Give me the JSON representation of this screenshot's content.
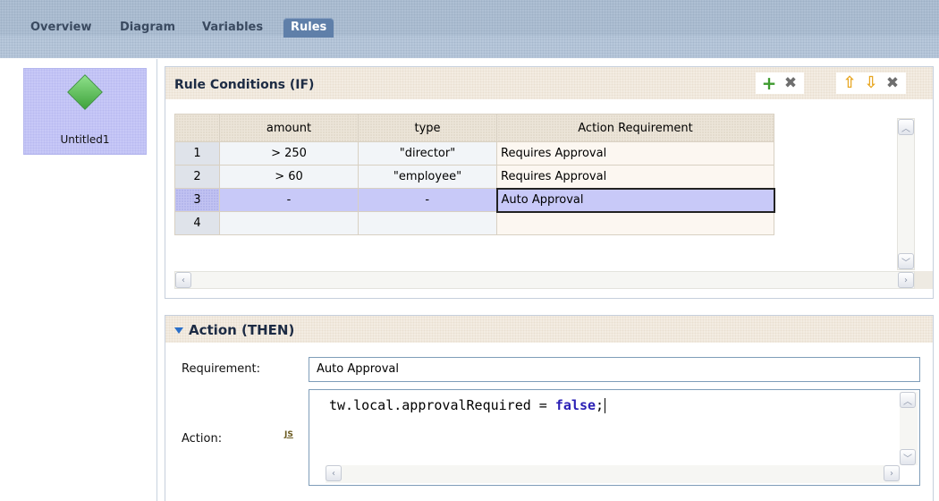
{
  "tabs": [
    {
      "label": "Overview"
    },
    {
      "label": "Diagram"
    },
    {
      "label": "Variables"
    },
    {
      "label": "Rules",
      "active": true
    }
  ],
  "palette": {
    "step_label": "Untitled1",
    "step_icon": "green-diamond-icon"
  },
  "conditions": {
    "title": "Rule Conditions (IF)",
    "toolbar_icons": [
      "add-icon",
      "delete-icon",
      "move-up-icon",
      "move-down-icon",
      "remove-icon"
    ],
    "columns": [
      "amount",
      "type",
      "Action Requirement"
    ],
    "rows": [
      {
        "num": "1",
        "amount": "> 250",
        "type": "\"director\"",
        "action": "Requires Approval"
      },
      {
        "num": "2",
        "amount": "> 60",
        "type": "\"employee\"",
        "action": "Requires Approval"
      },
      {
        "num": "3",
        "amount": "-",
        "type": "-",
        "action": "Auto Approval"
      },
      {
        "num": "4",
        "amount": "",
        "type": "",
        "action": ""
      }
    ]
  },
  "action": {
    "title": "Action (THEN)",
    "requirement_label": "Requirement:",
    "requirement_value": "Auto Approval",
    "action_label": "Action:",
    "js_badge": "JS",
    "code_prefix": "tw.local.approvalRequired = ",
    "code_keyword": "false",
    "code_suffix": ";"
  },
  "colors": {
    "active_tab": "#5f7fa9",
    "selected_row": "#c8c9f8",
    "keyword": "#2a1fb5"
  }
}
